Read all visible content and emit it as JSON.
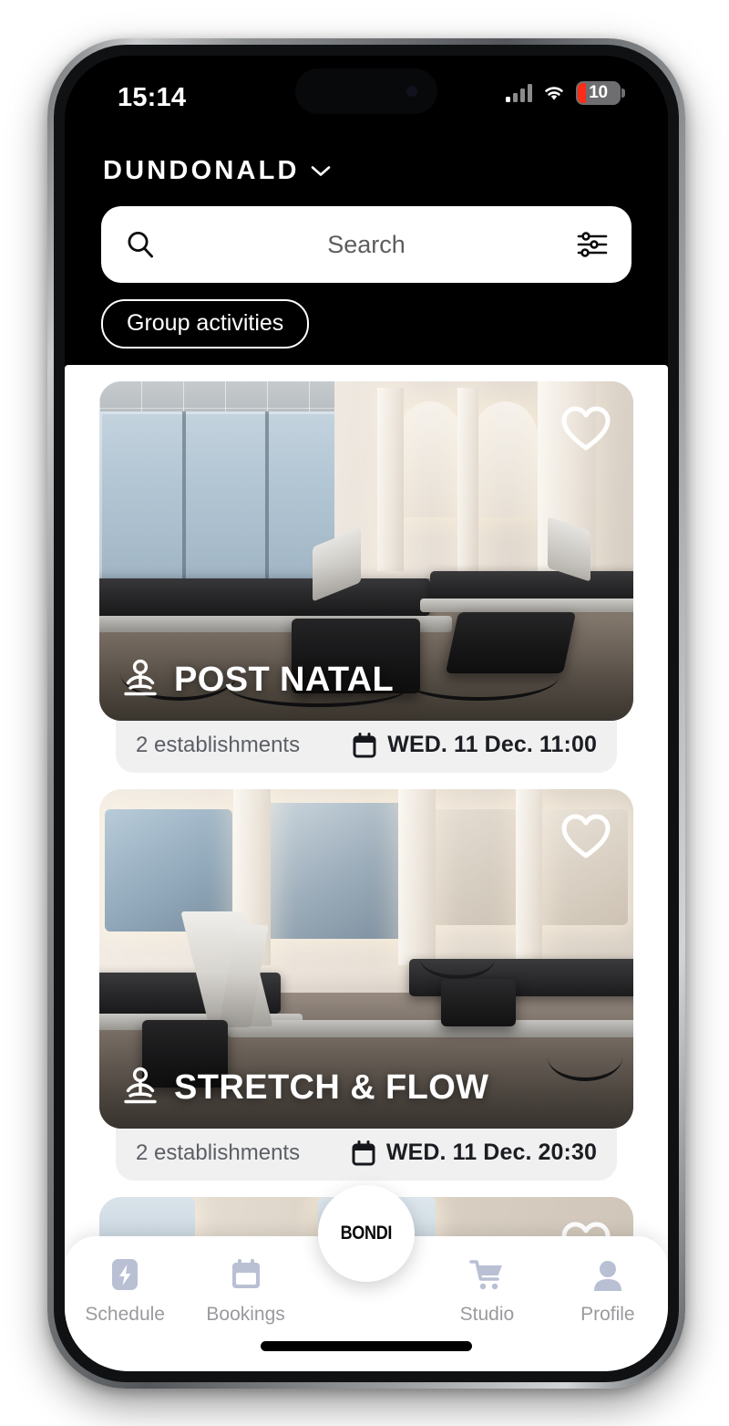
{
  "status_bar": {
    "time": "15:14",
    "battery_percent": "10",
    "battery_color": "#ff2d17",
    "signal_icon": "cellular-signal-icon",
    "wifi_icon": "wifi-icon"
  },
  "header": {
    "location": "DUNDONALD",
    "location_chevron_icon": "chevron-down-icon"
  },
  "search": {
    "placeholder": "Search",
    "value": "",
    "search_icon": "search-icon",
    "filter_icon": "filter-sliders-icon"
  },
  "filters": {
    "chips": [
      {
        "label": "Group activities",
        "selected": true
      }
    ]
  },
  "cards": [
    {
      "title": "POST NATAL",
      "activity_icon": "yoga-person-icon",
      "favorite_icon": "heart-outline-icon",
      "establishments": "2 establishments",
      "calendar_icon": "calendar-icon",
      "schedule": "WED. 11 Dec. 11:00"
    },
    {
      "title": "STRETCH & FLOW",
      "activity_icon": "yoga-person-icon",
      "favorite_icon": "heart-outline-icon",
      "establishments": "2 establishments",
      "calendar_icon": "calendar-icon",
      "schedule": "WED. 11 Dec. 20:30"
    },
    {
      "title": "",
      "activity_icon": "yoga-person-icon",
      "favorite_icon": "heart-outline-icon",
      "establishments": "",
      "calendar_icon": "calendar-icon",
      "schedule": ""
    }
  ],
  "tabbar": {
    "items": [
      {
        "label": "Schedule",
        "icon": "lightning-bolt-icon",
        "active": false
      },
      {
        "label": "Bookings",
        "icon": "calendar-icon",
        "active": false
      },
      {
        "label": "",
        "icon": "bondi-logo-icon",
        "active": false
      },
      {
        "label": "Studio",
        "icon": "shopping-cart-icon",
        "active": false
      },
      {
        "label": "Profile",
        "icon": "user-avatar-icon",
        "active": false
      }
    ],
    "icon_color": "#b9c0d4",
    "label_color": "#9a9a9e"
  },
  "fab": {
    "label": "BONDI"
  }
}
